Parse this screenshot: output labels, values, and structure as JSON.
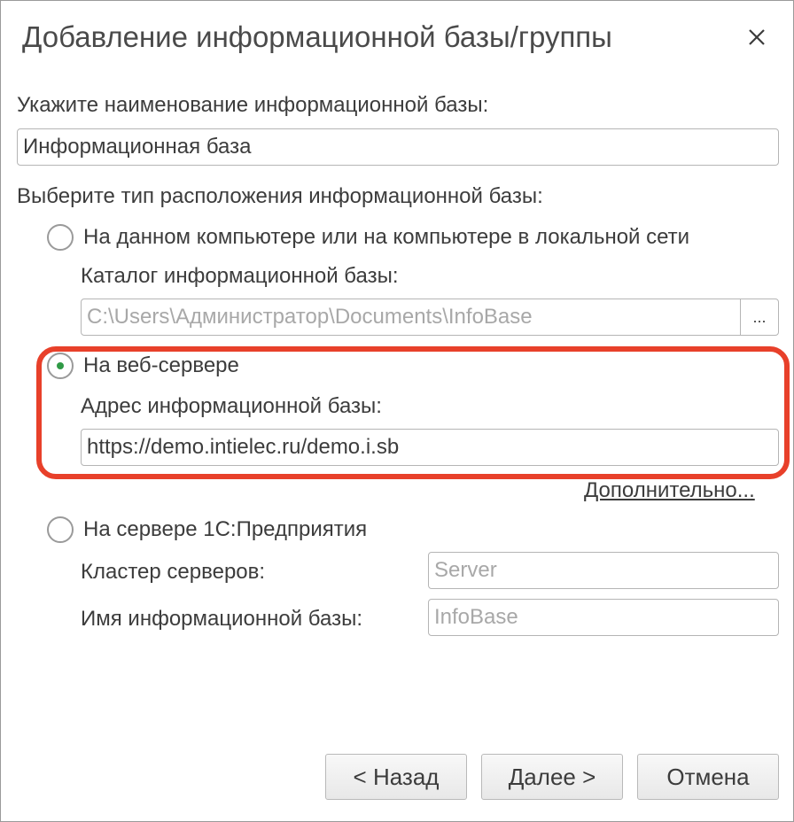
{
  "dialog": {
    "title": "Добавление информационной базы/группы",
    "close_icon": "close-icon"
  },
  "name_section": {
    "label": "Укажите наименование информационной базы:",
    "value": "Информационная база"
  },
  "location_section": {
    "label": "Выберите тип расположения информационной базы:",
    "local": {
      "label": "На данном компьютере или на компьютере в локальной сети",
      "selected": false,
      "catalog_label": "Каталог информационной базы:",
      "catalog_value": "C:\\Users\\Администратор\\Documents\\InfoBase",
      "browse_label": "..."
    },
    "web": {
      "label": "На веб-сервере",
      "selected": true,
      "address_label": "Адрес информационной базы:",
      "address_value": "https://demo.intielec.ru/demo.i.sb",
      "more_link": "Дополнительно..."
    },
    "server": {
      "label": "На сервере 1С:Предприятия",
      "selected": false,
      "cluster_label": "Кластер серверов:",
      "cluster_placeholder": "Server",
      "ib_name_label": "Имя информационной базы:",
      "ib_name_placeholder": "InfoBase"
    }
  },
  "buttons": {
    "back": "< Назад",
    "next": "Далее >",
    "cancel": "Отмена"
  },
  "colors": {
    "highlight": "#e8402a",
    "radio_dot": "#2f9a46"
  }
}
